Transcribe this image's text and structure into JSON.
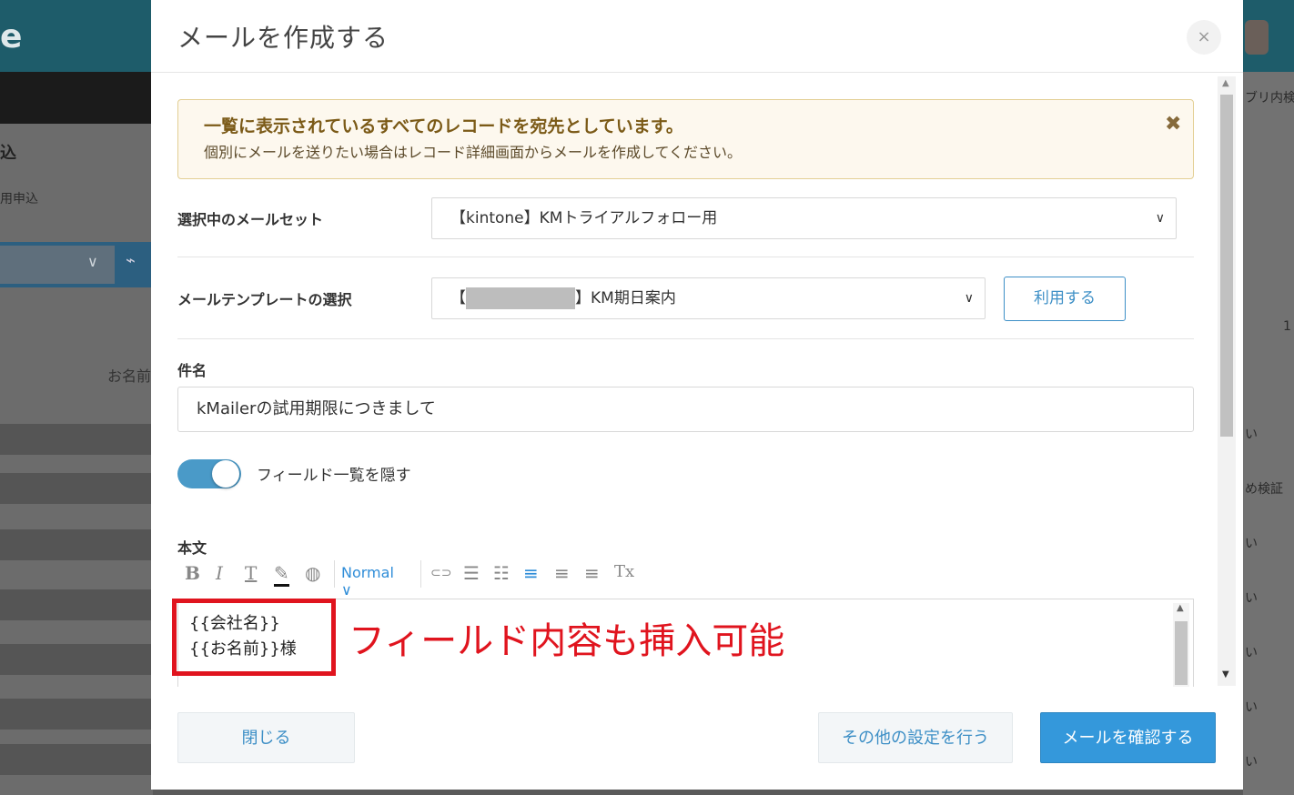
{
  "background": {
    "logo_fragment": "e",
    "left_title": "込",
    "left_subtitle": "用申込",
    "column_header": "お名前",
    "right_texts": [
      "ブリ内検",
      "1",
      "い",
      "め検証",
      "い",
      "い",
      "い",
      "い",
      "い"
    ]
  },
  "modal": {
    "title": "メールを作成する",
    "close_symbol": "×"
  },
  "notice": {
    "title": "一覧に表示されているすべてのレコードを宛先としています。",
    "text": "個別にメールを送りたい場合はレコード詳細画面からメールを作成してください。",
    "close_symbol": "✖"
  },
  "mail_set": {
    "label": "選択中のメールセット",
    "value": "【kintone】KMトライアルフォロー用"
  },
  "template": {
    "label": "メールテンプレートの選択",
    "value_prefix": "【",
    "value_suffix": "】KM期日案内",
    "use_button": "利用する"
  },
  "subject": {
    "label": "件名",
    "value": "kMailerの試用期限につきまして"
  },
  "field_toggle": {
    "label": "フィールド一覧を隠す",
    "on": true
  },
  "body": {
    "label": "本文",
    "toolbar": {
      "bold": "B",
      "italic": "I",
      "font": "T",
      "highlight": "✎",
      "color": "◍",
      "format": "Normal",
      "link": "⊂⊃",
      "bullet_list": "☰",
      "ordered_list": "☷",
      "align_left": "≡",
      "align_center": "≡",
      "align_right": "≡",
      "clear": "Tx"
    },
    "lines": [
      "{{会社名}}",
      "{{お名前}}様"
    ]
  },
  "footer": {
    "close": "閉じる",
    "other_settings": "その他の設定を行う",
    "confirm": "メールを確認する"
  },
  "annotation": {
    "text": "フィールド内容も挿入可能",
    "color": "#e0141e"
  },
  "colors": {
    "accent": "#3498db",
    "link": "#3d8fc6",
    "toggle": "#4a9ac8",
    "notice_bg": "#fdf8ee"
  }
}
